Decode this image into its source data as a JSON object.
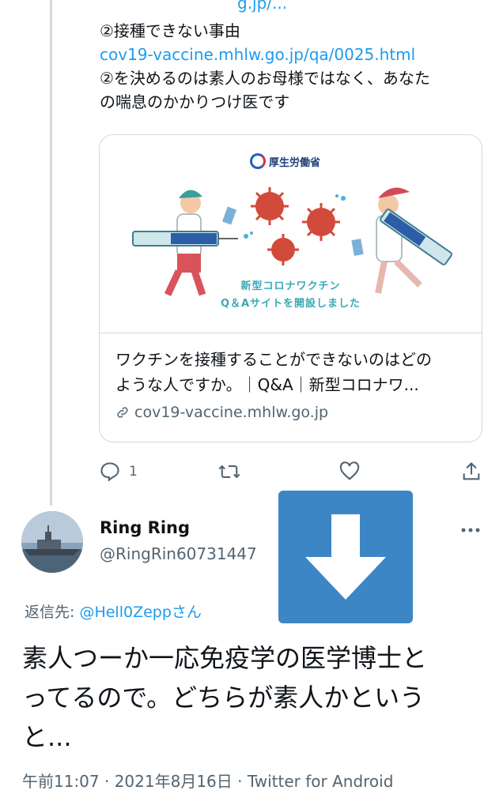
{
  "parent_tweet": {
    "top_cut_text": "g.jp/...",
    "lines": [
      "②接種できない事由",
      "cov19-vaccine.mhlw.go.jp/qa/0025.html",
      "②を決めるのは素人のお母様ではなく、あなた",
      "の喘息のかかりつけ医です"
    ],
    "card": {
      "ministry_name": "厚生労働省",
      "banner_line1": "新型コロナワクチン",
      "banner_line2": "Q＆Aサイトを開設しました",
      "title_line1": "ワクチンを接種することができないのはどの",
      "title_line2": "ような人ですか。｜Q&A｜新型コロナワ...",
      "domain": "cov19-vaccine.mhlw.go.jp"
    },
    "actions": {
      "reply_count": "1"
    }
  },
  "reply_tweet": {
    "author_name": "Ring Ring",
    "author_handle": "@RingRin60731447",
    "reply_to_label": "返信先: ",
    "reply_to_mention": "@Hell0Zepp",
    "reply_to_suffix": "さん",
    "text_lines": [
      "素人つーか一応免疫学の医学博士と",
      "ってるので。どちらが素人かという",
      "と..."
    ],
    "meta": "午前11:07 · 2021年8月16日 · Twitter for Android"
  },
  "colors": {
    "link": "#1d9bf0",
    "muted": "#536471",
    "overlay": "#3d86c6"
  }
}
